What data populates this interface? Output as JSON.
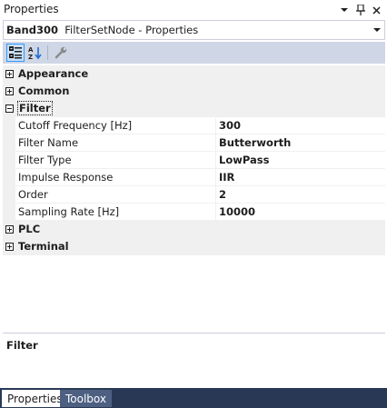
{
  "window": {
    "title": "Properties",
    "controls": [
      "dropdown-icon",
      "pin-icon",
      "close-icon"
    ]
  },
  "selector": {
    "object_name": "Band300",
    "object_type": "FilterSetNode - Properties"
  },
  "toolbar": {
    "buttons": [
      {
        "icon": "categorized-icon",
        "active": true
      },
      {
        "icon": "alphabetical-icon",
        "active": false
      },
      {
        "icon": "property-pages-icon",
        "active": false
      }
    ]
  },
  "grid": {
    "categories": [
      {
        "label": "Appearance",
        "expanded": false
      },
      {
        "label": "Common",
        "expanded": false
      },
      {
        "label": "Filter",
        "expanded": true,
        "selected": true,
        "properties": [
          {
            "name": "Cutoff Frequency [Hz]",
            "value": "300"
          },
          {
            "name": "Filter Name",
            "value": "Butterworth"
          },
          {
            "name": "Filter Type",
            "value": "LowPass"
          },
          {
            "name": "Impulse Response",
            "value": "IIR"
          },
          {
            "name": "Order",
            "value": "2"
          },
          {
            "name": "Sampling Rate [Hz]",
            "value": "10000"
          }
        ]
      },
      {
        "label": "PLC",
        "expanded": false
      },
      {
        "label": "Terminal",
        "expanded": false
      }
    ]
  },
  "description": {
    "title": "Filter",
    "text": ""
  },
  "tabs": [
    {
      "label": "Properties",
      "active": true
    },
    {
      "label": "Toolbox",
      "active": false
    }
  ],
  "colors": {
    "toolbar_bg": "#cfd6e5",
    "tabbar_bg": "#293955",
    "active_button_border": "#3399ff",
    "gutter": "#f0f0f0"
  }
}
